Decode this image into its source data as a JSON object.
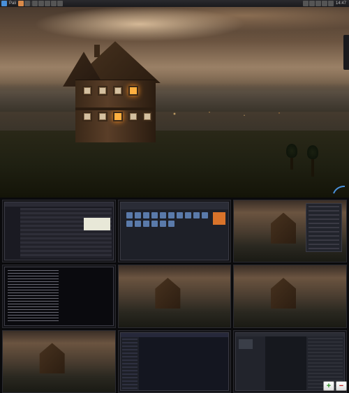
{
  "panel": {
    "left": {
      "menu_label": "Pali",
      "icons": [
        "app-menu",
        "home",
        "lock",
        "separator",
        "tool1",
        "tool2",
        "tool3",
        "tool4"
      ]
    },
    "right": {
      "icons": [
        "update",
        "network",
        "volume",
        "chat",
        "bluetooth"
      ],
      "clock": "14:47"
    }
  },
  "wallpaper": {
    "description": "Alpine chalet at dusk overlooking valley",
    "accent": "arc-gauge"
  },
  "workspaces": [
    {
      "id": 1,
      "type": "browser",
      "title": "Web browser with tabs"
    },
    {
      "id": 2,
      "type": "filemanager",
      "title": "File manager grid view"
    },
    {
      "id": 3,
      "type": "desktop-menu",
      "title": "Desktop with context menu"
    },
    {
      "id": 4,
      "type": "terminal",
      "title": "Terminal with output"
    },
    {
      "id": 5,
      "type": "desktop",
      "title": "Clean desktop"
    },
    {
      "id": 6,
      "type": "desktop",
      "title": "Clean desktop"
    },
    {
      "id": 7,
      "type": "desktop",
      "title": "Clean desktop"
    },
    {
      "id": 8,
      "type": "ide",
      "title": "IDE / code editor"
    },
    {
      "id": 9,
      "type": "editor",
      "title": "Image/media editor"
    }
  ],
  "pager": {
    "add_label": "+",
    "remove_label": "−"
  }
}
